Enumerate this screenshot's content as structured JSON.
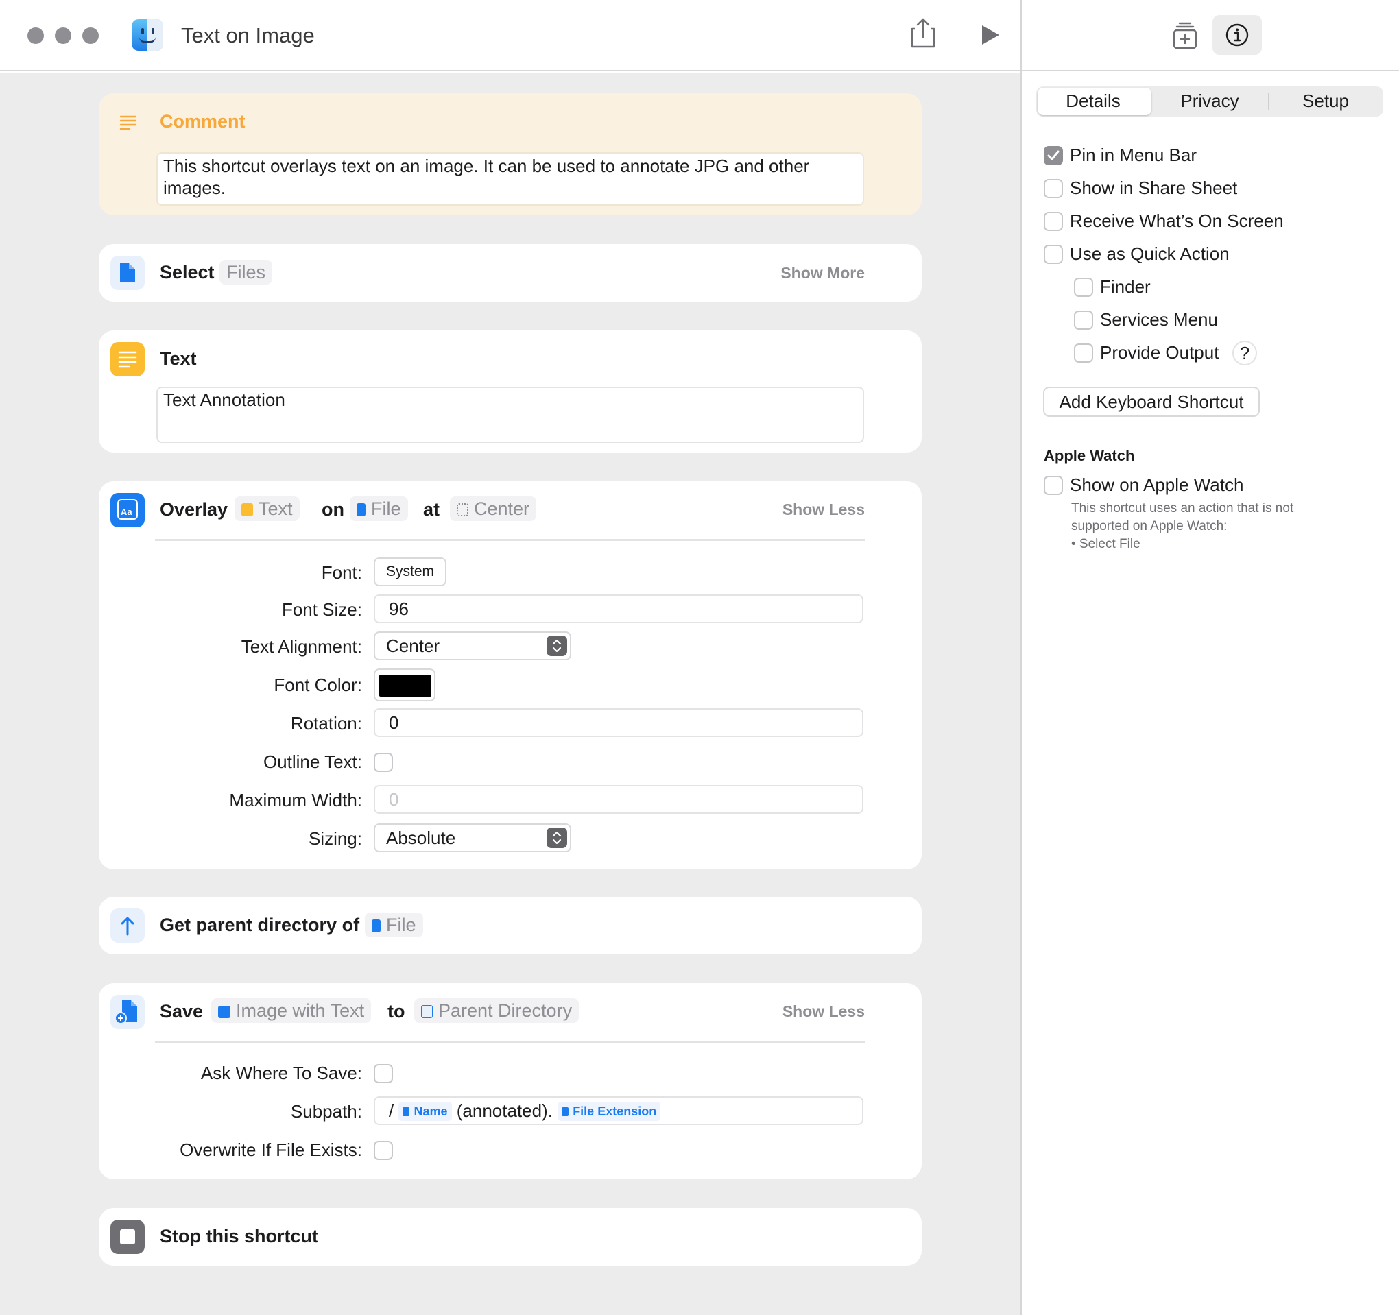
{
  "window": {
    "title": "Text on Image"
  },
  "comment": {
    "title": "Comment",
    "text": "This shortcut overlays text on an image. It can be used to annotate JPG and other images."
  },
  "select": {
    "action": "Select",
    "param": "Files",
    "show_more": "Show More"
  },
  "text_action": {
    "title": "Text",
    "value": "Text Annotation"
  },
  "overlay": {
    "action": "Overlay",
    "text_param": "Text",
    "on": "on",
    "file_param": "File",
    "at": "at",
    "position_param": "Center",
    "show_less": "Show Less",
    "font_label": "Font:",
    "font_value": "System",
    "font_size_label": "Font Size:",
    "font_size_value": "96",
    "alignment_label": "Text Alignment:",
    "alignment_value": "Center",
    "font_color_label": "Font Color:",
    "font_color_value": "#000000",
    "rotation_label": "Rotation:",
    "rotation_value": "0",
    "outline_label": "Outline Text:",
    "max_width_label": "Maximum Width:",
    "max_width_placeholder": "0",
    "sizing_label": "Sizing:",
    "sizing_value": "Absolute"
  },
  "parent_dir": {
    "action": "Get parent directory of",
    "param": "File"
  },
  "save": {
    "action": "Save",
    "input_param": "Image with Text",
    "to": "to",
    "dest_param": "Parent Directory",
    "show_less": "Show Less",
    "ask_label": "Ask Where To Save:",
    "subpath_label": "Subpath:",
    "subpath_slash": "/",
    "subpath_name_token": "Name",
    "subpath_middle": "(annotated).",
    "subpath_ext_token": "File Extension",
    "overwrite_label": "Overwrite If File Exists:"
  },
  "stop": {
    "title": "Stop this shortcut"
  },
  "inspector": {
    "tabs": [
      "Details",
      "Privacy",
      "Setup"
    ],
    "active_tab": "Details",
    "options": {
      "pin_menu_bar": "Pin in Menu Bar",
      "share_sheet": "Show in Share Sheet",
      "receive_screen": "Receive What’s On Screen",
      "quick_action": "Use as Quick Action",
      "finder": "Finder",
      "services_menu": "Services Menu",
      "provide_output": "Provide Output"
    },
    "help": "?",
    "keyboard_shortcut": "Add Keyboard Shortcut",
    "apple_watch_heading": "Apple Watch",
    "show_on_watch": "Show on Apple Watch",
    "watch_note_line1": "This shortcut uses an action that is not",
    "watch_note_line2": "supported on Apple Watch:",
    "watch_note_line3": "• Select File"
  },
  "colors": {
    "accent_blue": "#1b7cf0",
    "text_icon_yellow": "#fbbd2f",
    "comment_orange": "#f7a83a",
    "comment_bg": "#fbf1e1",
    "editor_bg": "#ececec"
  },
  "icons": [
    "finder-icon",
    "share-icon",
    "play-icon",
    "library-icon",
    "info-icon",
    "comment-icon",
    "file-icon",
    "text-icon",
    "overlay-icon",
    "parent-directory-icon",
    "save-file-icon",
    "stop-icon"
  ]
}
